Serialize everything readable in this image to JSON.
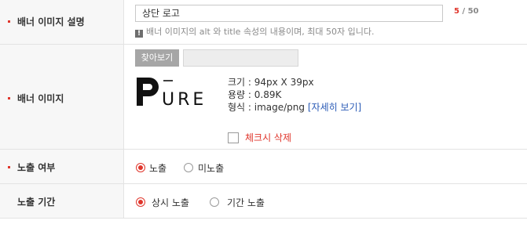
{
  "rows": {
    "desc": {
      "label": "배너 이미지 설명",
      "value": "상단 로고",
      "counter_current": "5",
      "counter_sep": " / ",
      "counter_max": "50",
      "hint": "배너 이미지의 alt 와 title 속성의 내용이며, 최대 50자 입니다."
    },
    "image": {
      "label": "배너 이미지",
      "find_button": "찾아보기",
      "logo_text": "PURE",
      "size": "크기 : 94px X 39px",
      "capacity": "용량 : 0.89K",
      "format": "형식 : image/png",
      "detail_link": "[자세히 보기]",
      "delete_label": "체크시 삭제"
    },
    "exposure": {
      "label": "노출 여부",
      "options": [
        "노출",
        "미노출"
      ],
      "selected": 0
    },
    "period": {
      "label": "노출 기간",
      "options": [
        "상시 노출",
        "기간 노출"
      ],
      "selected": 0
    }
  },
  "colors": {
    "accent": "#e0362c",
    "link": "#2b5bb6",
    "label_bg": "#f7f7f7"
  },
  "icons": {
    "hint": "exclamation-icon"
  }
}
